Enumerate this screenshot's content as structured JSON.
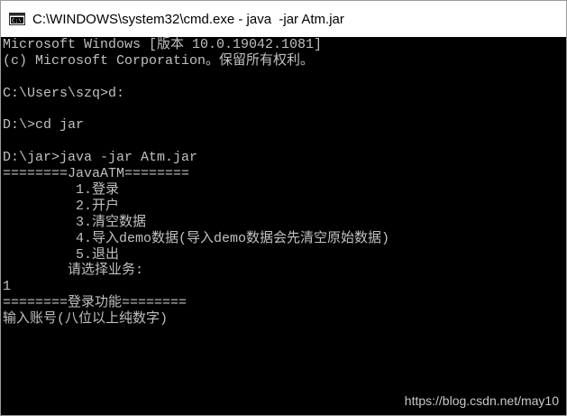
{
  "window": {
    "title": "C:\\WINDOWS\\system32\\cmd.exe - java  -jar Atm.jar",
    "title_icon": "cmd-prompt-icon"
  },
  "console": {
    "lines": [
      "Microsoft Windows [版本 10.0.19042.1081]",
      "(c) Microsoft Corporation。保留所有权利。",
      "",
      "C:\\Users\\szq>d:",
      "",
      "D:\\>cd jar",
      "",
      "D:\\jar>java -jar Atm.jar",
      "========JavaATM========",
      "         1.登录",
      "         2.开户",
      "         3.清空数据",
      "         4.导入demo数据(导入demo数据会先清空原始数据)",
      "         5.退出",
      "        请选择业务:",
      "1",
      "========登录功能========",
      "输入账号(八位以上纯数字)"
    ]
  },
  "watermark": "https://blog.csdn.net/may10",
  "colors": {
    "console_background": "#000000",
    "console_text": "#c0c0c0",
    "titlebar_background": "#ffffff"
  }
}
